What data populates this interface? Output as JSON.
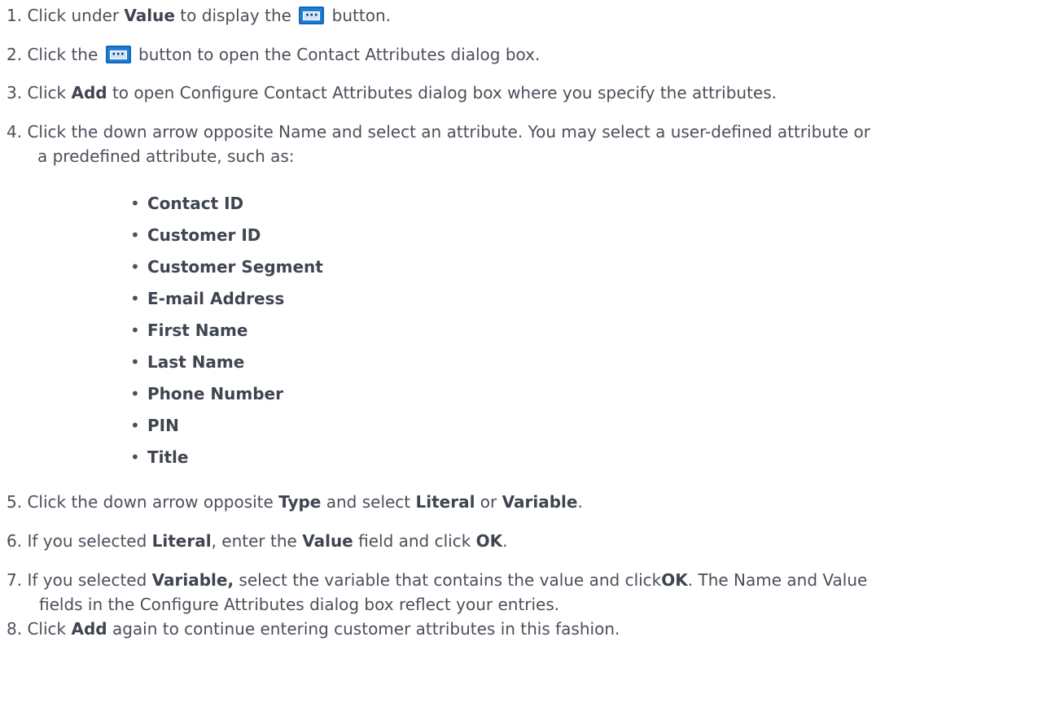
{
  "steps": [
    {
      "num": "1.",
      "parts": [
        "Click under ",
        "Value",
        " to display the ",
        "",
        " button."
      ]
    },
    {
      "num": "2.",
      "parts": [
        "Click the ",
        "",
        " button to open the Contact Attributes dialog box."
      ]
    },
    {
      "num": "3.",
      "parts": [
        "Click ",
        "Add",
        " to open Configure Contact Attributes dialog box where you specify the attributes."
      ]
    },
    {
      "num": "4.",
      "line1": "Click the down arrow opposite Name and select an attribute. You may select a user-defined attribute or",
      "line2": "a predefined attribute, such as:"
    },
    {
      "num": "5.",
      "parts": [
        "Click the down arrow opposite ",
        "Type",
        " and select ",
        "Literal",
        " or ",
        "Variable",
        "."
      ]
    },
    {
      "num": "6.",
      "parts": [
        "If you selected ",
        "Literal",
        ", enter the ",
        "Value",
        " field and click ",
        "OK",
        "."
      ]
    },
    {
      "num": "7.",
      "parts": [
        "If you selected ",
        "Variable,",
        " select the variable that contains the value and click",
        "OK",
        ". The Name and Value"
      ],
      "line2": "fields in the Configure Attributes dialog box reflect your entries."
    },
    {
      "num": "8.",
      "parts": [
        "Click ",
        "Add",
        " again to continue entering customer attributes in this fashion."
      ]
    }
  ],
  "attributes": [
    "Contact ID",
    "Customer ID",
    "Customer Segment",
    "E-mail Address",
    "First Name",
    "Last Name",
    "Phone Number",
    "PIN",
    "Title"
  ],
  "bullet_char": "•",
  "icon": {
    "name": "ellipsis-button-icon",
    "color": "#1f7fd4"
  }
}
